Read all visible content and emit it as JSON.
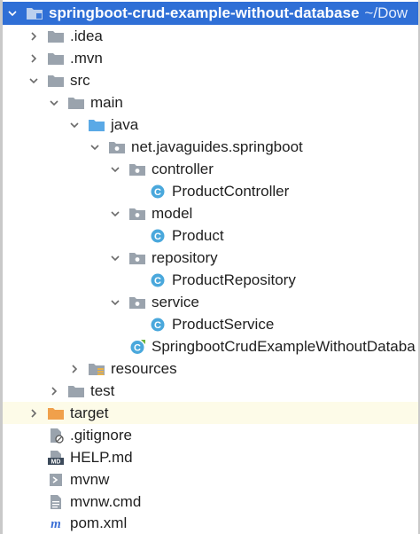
{
  "project": {
    "name": "springboot-crud-example-without-database",
    "path": "~/Dow"
  },
  "tree": {
    "idea": ".idea",
    "mvn": ".mvn",
    "src": "src",
    "main": "main",
    "java": "java",
    "package": "net.javaguides.springboot",
    "controller": "controller",
    "product_controller": "ProductController",
    "model": "model",
    "product": "Product",
    "repository": "repository",
    "product_repository": "ProductRepository",
    "service": "service",
    "product_service": "ProductService",
    "app_class": "SpringbootCrudExampleWithoutDataba",
    "resources": "resources",
    "test": "test",
    "target": "target",
    "gitignore": ".gitignore",
    "help": "HELP.md",
    "mvnw": "mvnw",
    "mvnw_cmd": "mvnw.cmd",
    "pom": "pom.xml"
  },
  "icons": {
    "folder": "folder-icon",
    "source_root": "source-folder-icon",
    "package": "package-icon",
    "class": "java-class-icon",
    "spring_class": "spring-boot-class-icon",
    "resources": "resources-folder-icon",
    "excluded": "excluded-folder-icon",
    "gitignore": "ignore-file-icon",
    "markdown": "markdown-file-icon",
    "script": "script-file-icon",
    "text": "text-file-icon",
    "maven": "maven-icon"
  },
  "colors": {
    "selection": "#2f6fd6",
    "highlight_row": "#fdfbe8",
    "folder_gray": "#9aa3ad",
    "source_blue": "#5aa9e6",
    "class_blue": "#4aa8dc",
    "excluded_orange": "#f0a04b",
    "spring_green": "#6db33f"
  }
}
